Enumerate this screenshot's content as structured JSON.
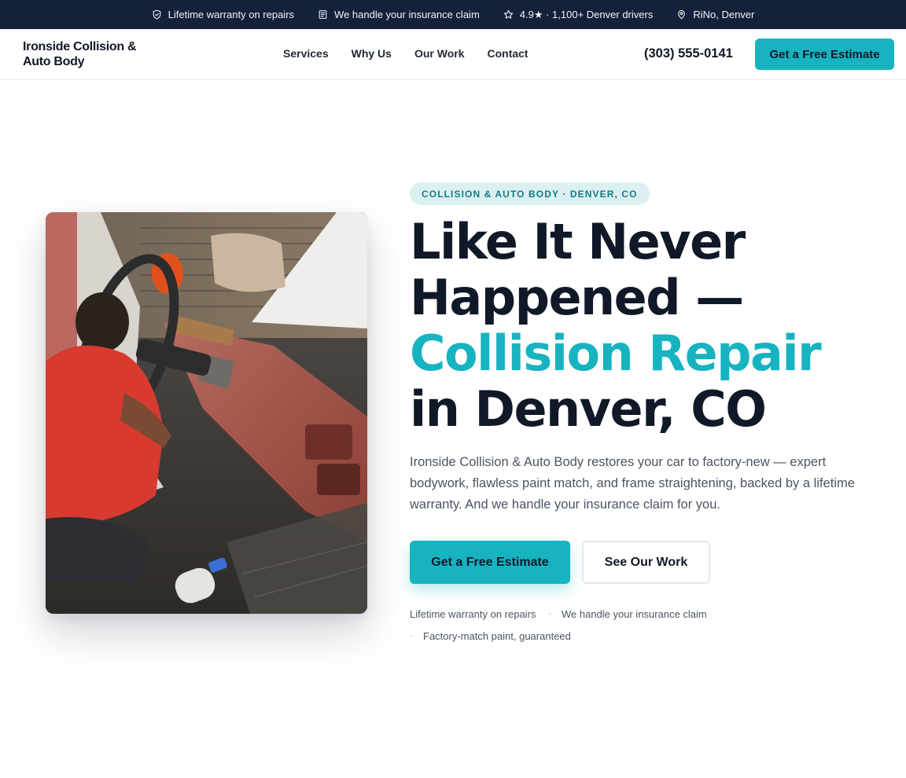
{
  "topbar": {
    "items": [
      {
        "icon": "shield-icon",
        "text": "Lifetime warranty on repairs"
      },
      {
        "icon": "clipboard-icon",
        "text": "We handle your insurance claim"
      },
      {
        "icon": "star-icon",
        "text": "4.9★ · 1,100+ Denver drivers"
      },
      {
        "icon": "map-pin-icon",
        "text": "RiNo, Denver"
      }
    ]
  },
  "nav": {
    "logo": "Ironside Collision & Auto Body",
    "links": [
      "Services",
      "Why Us",
      "Our Work",
      "Contact"
    ],
    "phone": "(303) 555-0141",
    "cta_label": "Get a Free Estimate"
  },
  "hero": {
    "eyebrow": "COLLISION & AUTO BODY · DENVER, CO",
    "headline": {
      "line1": "Like It Never",
      "line2": "Happened —",
      "accent": "Collision Repair",
      "line4": "in Denver, CO"
    },
    "lead": "Ironside Collision & Auto Body restores your car to factory-new — expert bodywork, flawless paint match, and frame straightening, backed by a lifetime warranty. And we handle your insurance claim for you.",
    "primary_cta": "Get a Free Estimate",
    "secondary_cta": "See Our Work",
    "trust_points": [
      "Lifetime warranty on repairs",
      "We handle your insurance claim",
      "Factory-match paint, guaranteed"
    ],
    "separator": "·"
  },
  "colors": {
    "accent": "#17b3c1",
    "topbar_bg": "#14213a",
    "eyebrow_bg": "#ddf0f1",
    "text_dark": "#111827",
    "text_muted": "#4b5563"
  }
}
